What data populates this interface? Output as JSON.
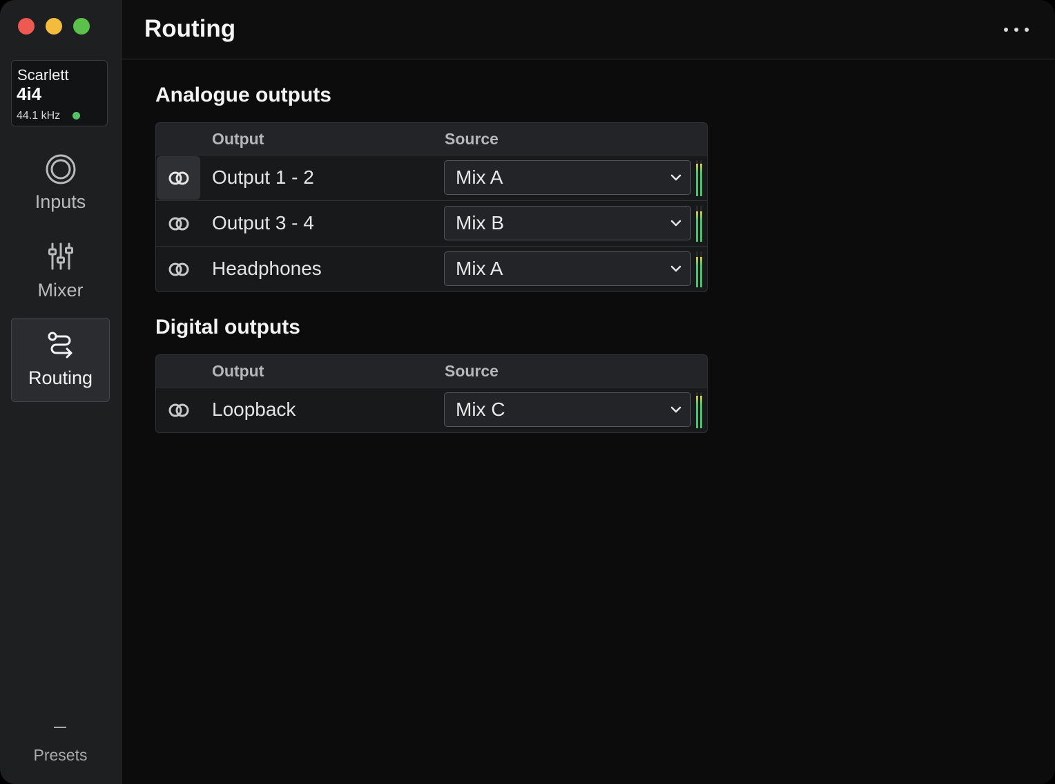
{
  "device": {
    "brand": "Scarlett",
    "model": "4i4",
    "sample_rate": "44.1 kHz",
    "status_color": "#54c265"
  },
  "nav": {
    "inputs": {
      "label": "Inputs",
      "icon": "inputs-rings-icon"
    },
    "mixer": {
      "label": "Mixer",
      "icon": "mixer-sliders-icon"
    },
    "routing": {
      "label": "Routing",
      "icon": "routing-path-icon"
    },
    "presets": {
      "label": "Presets"
    }
  },
  "header": {
    "title": "Routing",
    "more_icon": "more-horizontal-icon"
  },
  "analogue": {
    "title": "Analogue outputs",
    "col_output": "Output",
    "col_source": "Source",
    "rows": [
      {
        "output": "Output 1 - 2",
        "source": "Mix A",
        "meter_level": 0.9
      },
      {
        "output": "Output 3 - 4",
        "source": "Mix B",
        "meter_level": 0.85
      },
      {
        "output": "Headphones",
        "source": "Mix A",
        "meter_level": 0.85
      }
    ]
  },
  "digital": {
    "title": "Digital outputs",
    "col_output": "Output",
    "col_source": "Source",
    "rows": [
      {
        "output": "Loopback",
        "source": "Mix C",
        "meter_level": 0.9
      }
    ]
  },
  "colors": {
    "accent_green": "#46c26a",
    "meter_peak": "#d8c44a",
    "close": "#ee5a52",
    "minimize": "#f4bc3d",
    "zoom": "#5cc14b"
  }
}
